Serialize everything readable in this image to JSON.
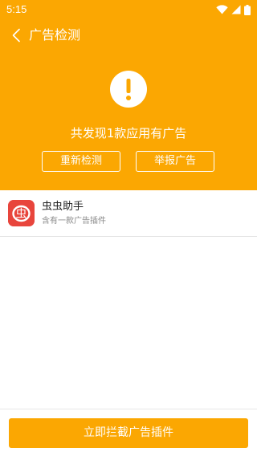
{
  "status_bar": {
    "time": "5:15",
    "icons": [
      "wifi-icon",
      "signal-icon",
      "battery-icon"
    ]
  },
  "app_bar": {
    "back_icon": "chevron-left-icon",
    "title": "广告检测"
  },
  "hero": {
    "icon": "exclamation-circle-icon",
    "message": "共发现1款应用有广告",
    "recheck_label": "重新检测",
    "report_label": "举报广告"
  },
  "apps": [
    {
      "name": "虫虫助手",
      "description": "含有一款广告插件",
      "icon_glyph": "虫"
    }
  ],
  "actions": {
    "block_label": "立即拦截广告插件"
  },
  "colors": {
    "accent": "#fba702",
    "app_icon_bg": "#e8453c",
    "divider": "#e4e4e4",
    "text_primary": "#222222",
    "text_secondary": "#8a8a8a"
  }
}
